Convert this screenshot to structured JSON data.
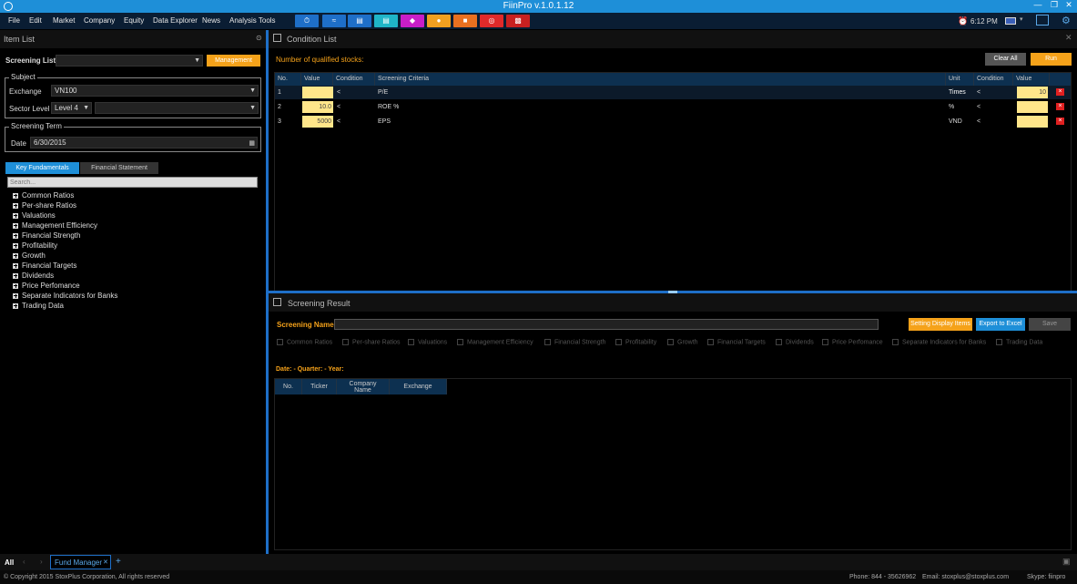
{
  "app": {
    "title": "FiinPro v.1.0.1.12"
  },
  "menu": [
    "File",
    "Edit",
    "Market",
    "Company",
    "Equity",
    "Data Explorer",
    "News",
    "Analysis Tools"
  ],
  "toolbar_colors": [
    "#1e6fc8",
    "#1e6fc8",
    "#1e6fc8",
    "#1fb5c8",
    "#c81ec8",
    "#f0a020",
    "#e87020",
    "#e02a2a",
    "#c82020"
  ],
  "toolbar_icons": [
    "clock-arrow-icon",
    "market-chart-icon",
    "bar-chart-icon",
    "document-icon",
    "ideas-icon",
    "group-icon",
    "presentation-icon",
    "target-icon",
    "analysis-icon"
  ],
  "status": {
    "time": "6:12 PM"
  },
  "item_list": {
    "title": "Item List",
    "screening_list_label": "Screening List",
    "management_btn": "Management",
    "subject_title": "Subject",
    "exchange_label": "Exchange",
    "exchange_value": "VN100",
    "sector_label": "Sector Level",
    "sector_value": "Level 4",
    "term_title": "Screening Term",
    "date_label": "Date",
    "date_value": "6/30/2015",
    "tab_key": "Key Fundamentals",
    "tab_fin": "Financial Statement",
    "search_placeholder": "Search...",
    "tree": [
      "Common Ratios",
      "Per-share Ratios",
      "Valuations",
      "Management Efficiency",
      "Financial Strength",
      "Profitability",
      "Growth",
      "Financial Targets",
      "Dividends",
      "Price Perfomance",
      "Separate Indicators for Banks",
      "Trading Data"
    ]
  },
  "condition": {
    "title": "Condition List",
    "qualified_label": "Number of qualified stocks:",
    "clear_all": "Clear All",
    "run": "Run",
    "headers": [
      "No.",
      "Value",
      "Condition",
      "Screening Criteria",
      "Unit",
      "Condition",
      "Value"
    ],
    "rows": [
      {
        "no": "1",
        "value": "",
        "cond": "<",
        "criteria": "P/E",
        "unit": "Times",
        "cond2": "<",
        "value2": "10"
      },
      {
        "no": "2",
        "value": "10.0",
        "cond": "<",
        "criteria": "ROE %",
        "unit": "%",
        "cond2": "<",
        "value2": ""
      },
      {
        "no": "3",
        "value": "5000",
        "cond": "<",
        "criteria": "EPS",
        "unit": "VND",
        "cond2": "<",
        "value2": ""
      }
    ],
    "delete_glyph": "×"
  },
  "result": {
    "title": "Screening Result",
    "name_label": "Screening Name",
    "btn_settings": "Setting Display Items",
    "btn_export": "Export to Excel",
    "btn_save": "Save",
    "checkboxes": [
      "Common Ratios",
      "Per-share Ratios",
      "Valuations",
      "Management Efficiency",
      "Financial Strength",
      "Profitability",
      "Growth",
      "Financial Targets",
      "Dividends",
      "Price Perfomance",
      "Separate Indicators for Banks",
      "Trading Data"
    ],
    "date_line": "Date:  - Quarter: - Year:",
    "headers": [
      "No.",
      "Ticker",
      "Company Name",
      "Exchange"
    ]
  },
  "bottom": {
    "all": "All",
    "tab": "Fund Manager",
    "copyright": "© Copyright 2015 StoxPlus Corporation, All rights reserved",
    "phone": "Phone: 844 - 35626962",
    "email": "Email: stoxplus@stoxplus.com",
    "skype": "Skype: fiinpro"
  }
}
